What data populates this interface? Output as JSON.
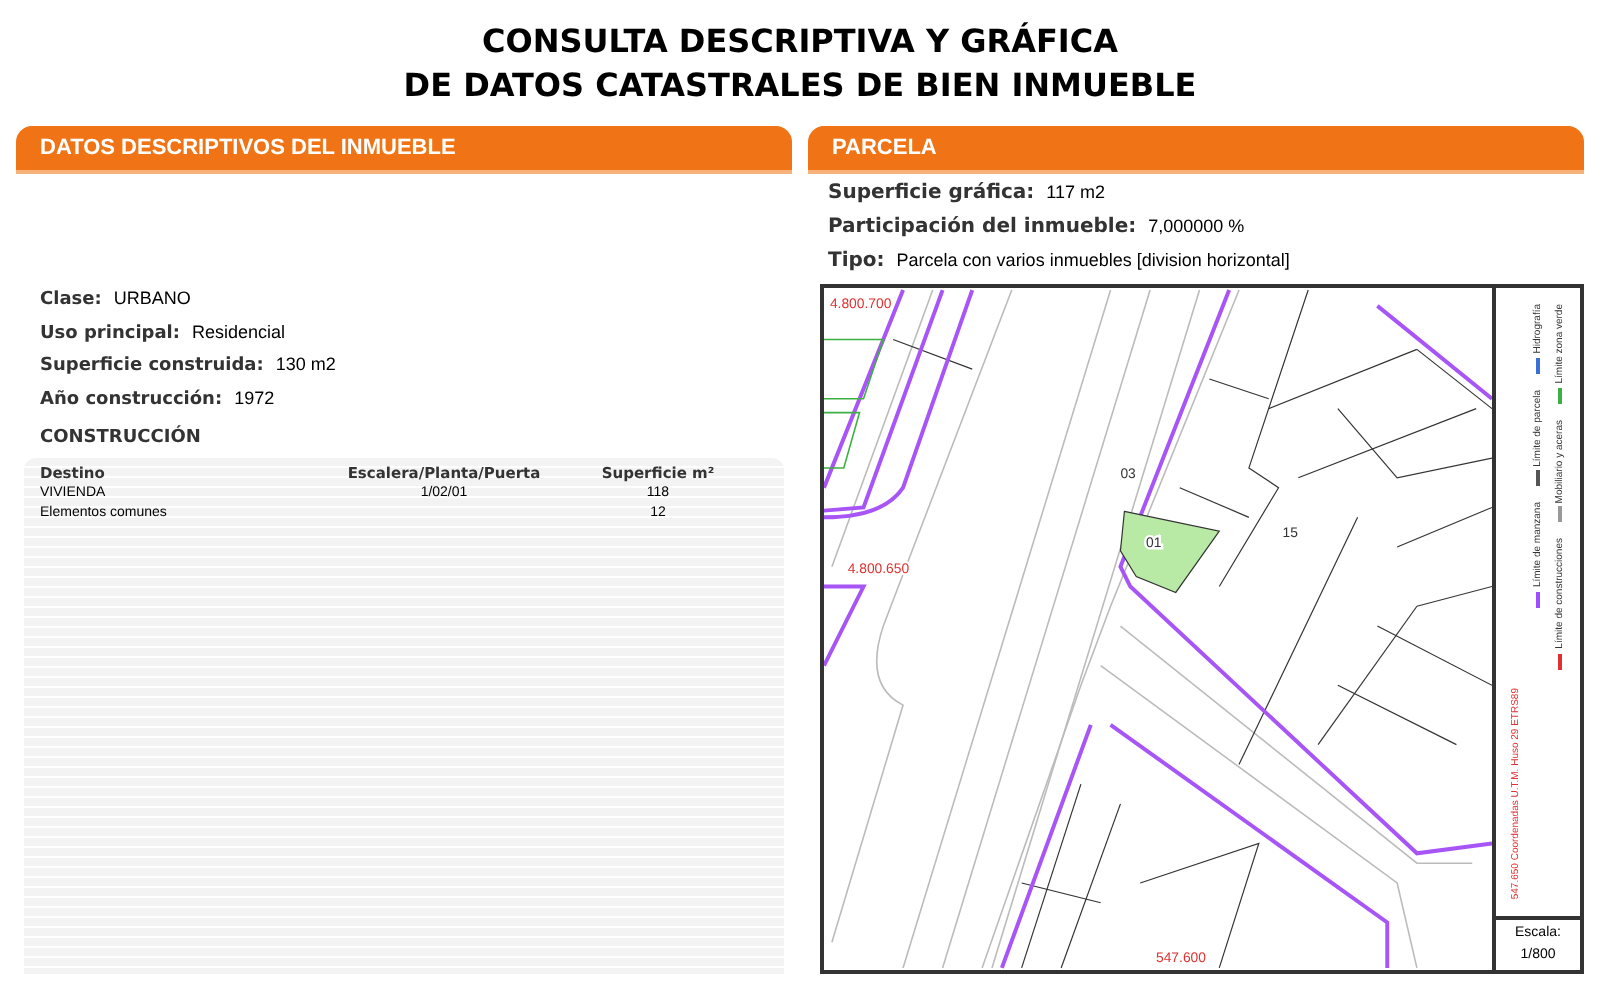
{
  "title_lines": [
    "CONSULTA DESCRIPTIVA Y GRÁFICA",
    "DE DATOS CATASTRALES DE BIEN INMUEBLE"
  ],
  "left_panel": {
    "header": "DATOS DESCRIPTIVOS DEL INMUEBLE",
    "fields": [
      {
        "label": "Clase:",
        "value": "URBANO"
      },
      {
        "label": "Uso principal:",
        "value": "Residencial"
      },
      {
        "label": "Superficie construida:",
        "value": "130 m2"
      },
      {
        "label": "Año construcción:",
        "value": "1972"
      }
    ],
    "construction": {
      "title": "CONSTRUCCIÓN",
      "columns": [
        "Destino",
        "Escalera/Planta/Puerta",
        "Superficie m²"
      ],
      "rows": [
        [
          "VIVIENDA",
          "1/02/01",
          "118"
        ],
        [
          "Elementos comunes",
          "",
          "12"
        ]
      ]
    }
  },
  "right_panel": {
    "header": "PARCELA",
    "fields": [
      {
        "label": "Superficie gráfica:",
        "value": "117 m2"
      },
      {
        "label": "Participación del inmueble:",
        "value": "7,000000 %"
      },
      {
        "label": "Tipo:",
        "value": "Parcela con varios inmuebles [division horizontal]"
      }
    ],
    "map": {
      "labels": [
        "4.800.700",
        "4.800.650",
        "03",
        "15",
        "01",
        "547.600"
      ],
      "coordinates_note": "547.650 Coordenadas U.T.M. Huso 29 ETRS89",
      "legend": [
        [
          {
            "label": "Límite de manzana",
            "color": "#9b4dff"
          },
          {
            "label": "Límite de parcela",
            "color": "#555555"
          },
          {
            "label": "Hidrografía",
            "color": "#3b6fd8"
          }
        ],
        [
          {
            "label": "Límite de construcciones",
            "color": "#e03030"
          },
          {
            "label": "Mobiliario y aceras",
            "color": "#999999"
          },
          {
            "label": "Límite zona verde",
            "color": "#3cb043"
          }
        ]
      ],
      "scale_label": "Escala:",
      "scale_value": "1/800"
    }
  }
}
